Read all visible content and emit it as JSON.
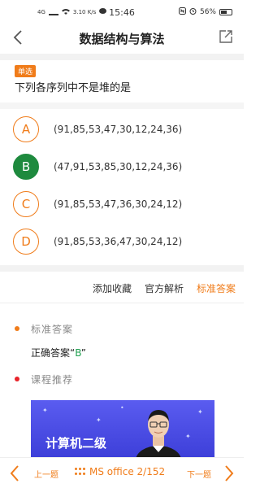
{
  "status_bar": {
    "network": "4G",
    "speed": "3.10 K/s",
    "time": "15:46",
    "battery": "56%"
  },
  "header": {
    "title": "数据结构与算法"
  },
  "question": {
    "tag": "单选",
    "text": "下列各序列中不是堆的是"
  },
  "options": [
    {
      "letter": "A",
      "text": "(91,85,53,47,30,12,24,36)",
      "correct": false
    },
    {
      "letter": "B",
      "text": "(47,91,53,85,30,12,24,36)",
      "correct": true
    },
    {
      "letter": "C",
      "text": "(91,85,53,47,36,30,24,12)",
      "correct": false
    },
    {
      "letter": "D",
      "text": "(91,85,53,36,47,30,24,12)",
      "correct": false
    }
  ],
  "actions": {
    "favorite": "添加收藏",
    "official": "官方解析",
    "standard": "标准答案"
  },
  "answer_section": {
    "title": "标准答案",
    "prefix": "正确答案“",
    "answer": "B",
    "suffix": "”"
  },
  "course_section": {
    "title": "课程推荐",
    "banner_text": "计算机二级"
  },
  "bottom_nav": {
    "prev": "上一题",
    "progress": "MS office 2/152",
    "next": "下一题"
  },
  "colors": {
    "accent": "#f07c1a",
    "correct": "#1e8a3e",
    "dot_orange": "#f07c1a",
    "dot_red": "#e8232a"
  }
}
